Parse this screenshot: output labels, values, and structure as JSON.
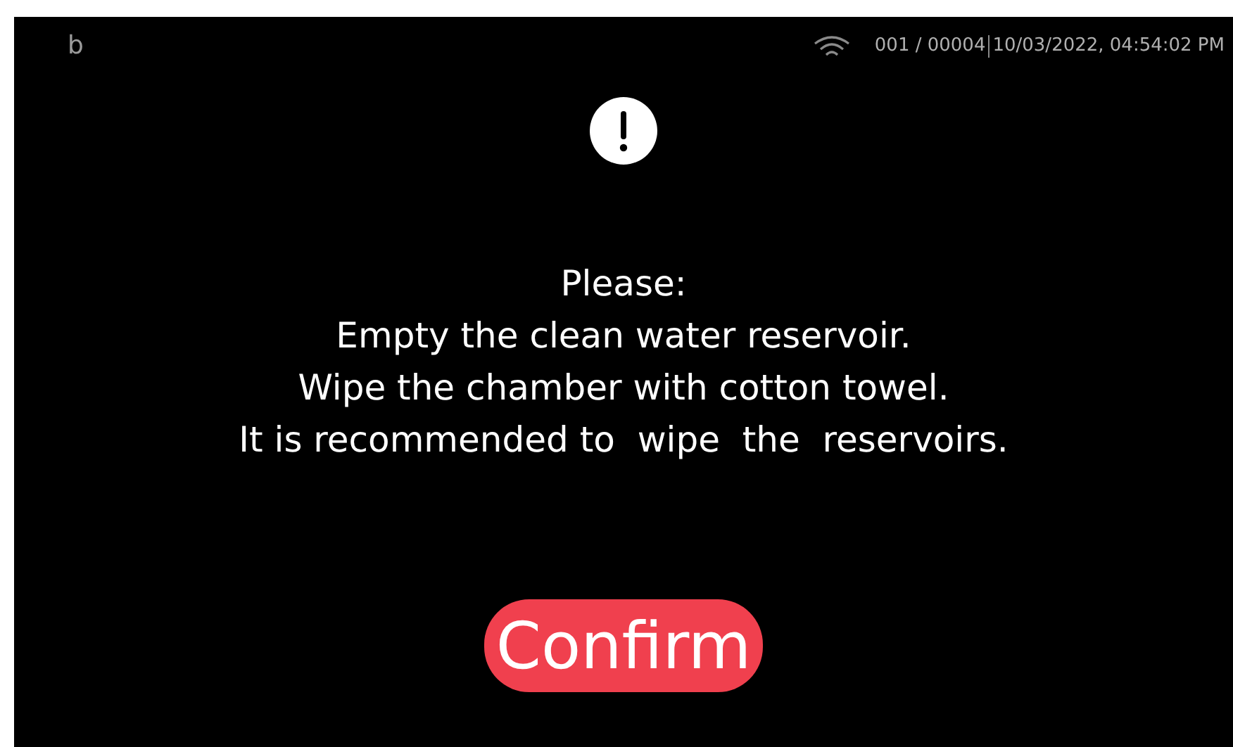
{
  "header": {
    "logo": "b",
    "counter": "001 / 00004",
    "datetime": "10/03/2022, 04:54:02 PM"
  },
  "message": {
    "lines": [
      "Please:",
      "Empty the clean water reservoir.",
      "Wipe the chamber with cotton towel.",
      "It is recommended to  wipe  the  reservoirs."
    ]
  },
  "buttons": [
    {
      "label": "Confirm"
    }
  ]
}
